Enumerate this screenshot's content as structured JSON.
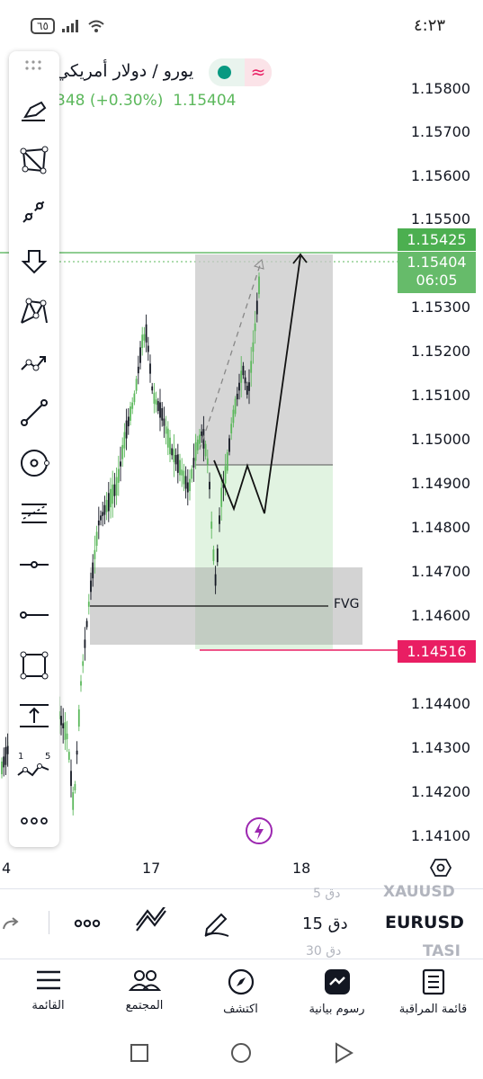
{
  "status_bar": {
    "time": "٤:٢٣",
    "battery": "٦٥"
  },
  "header": {
    "symbol_name": "يورو / دولار أمريكي",
    "change_text": "348 (+0.30%)",
    "last_price": "1.15404"
  },
  "colors": {
    "up": "#5cb85c",
    "down": "#131722",
    "green_line": "#4caf50",
    "red_line": "#e91e63",
    "accent": "#9c27b0"
  },
  "price_axis": [
    "1.15800",
    "1.15700",
    "1.15600",
    "1.15500",
    "1.15300",
    "1.15200",
    "1.15100",
    "1.15000",
    "1.14900",
    "1.14800",
    "1.14700",
    "1.14600",
    "1.14400",
    "1.14300",
    "1.14200",
    "1.14100"
  ],
  "price_tags": {
    "green_line_price": "1.15425",
    "current_price": "1.15404",
    "countdown": "06:05",
    "red_line_price": "1.14516"
  },
  "chart": {
    "annotation_fvg": "FVG",
    "time_labels": [
      "4",
      "17",
      "18"
    ]
  },
  "toolbar": {
    "tools": [
      "brush-tool-icon",
      "polygon-tool-icon",
      "line-pattern-icon",
      "arrow-down-icon",
      "xabcd-pattern-icon",
      "path-icon",
      "trend-line-icon",
      "circle-icon",
      "pitchfork-icon",
      "horizontal-ray-icon",
      "horizontal-line-icon",
      "rectangle-icon",
      "price-range-icon",
      "elliott-wave-icon",
      "more-icon"
    ]
  },
  "symbols_panel": {
    "prev_symbol": "XAUUSD",
    "prev_interval": "5 دق",
    "current_symbol": "EURUSD",
    "current_interval": "15 دق",
    "next_symbol": "TASI",
    "next_interval": "30 دق"
  },
  "bottom_nav": [
    {
      "label": "القائمة",
      "icon": "menu-icon"
    },
    {
      "label": "المجتمع",
      "icon": "community-icon"
    },
    {
      "label": "اكتشف",
      "icon": "compass-icon"
    },
    {
      "label": "رسوم بيانية",
      "icon": "chart-icon"
    },
    {
      "label": "قائمة المراقبة",
      "icon": "watchlist-icon"
    }
  ]
}
